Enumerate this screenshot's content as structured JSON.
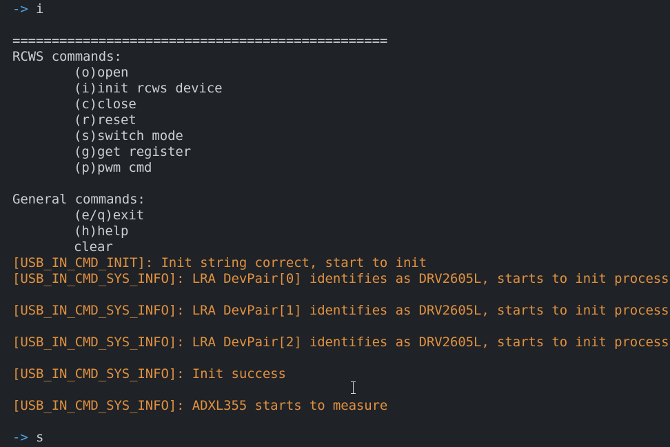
{
  "prompt_symbol": "->",
  "first_command": "i",
  "separator": "================================================",
  "rcws_header": "RCWS commands:",
  "rcws_items": [
    "(o)open",
    "(i)init rcws device",
    "(c)close",
    "(r)reset",
    "(s)switch mode",
    "(g)get register",
    "(p)pwm cmd"
  ],
  "general_header": "General commands:",
  "general_items": [
    "(e/q)exit",
    "(h)help",
    "clear"
  ],
  "log_lines": [
    "[USB_IN_CMD_INIT]: Init string correct, start to init",
    "[USB_IN_CMD_SYS_INFO]: LRA DevPair[0] identifies as DRV2605L, starts to init process",
    "[USB_IN_CMD_SYS_INFO]: LRA DevPair[1] identifies as DRV2605L, starts to init process",
    "[USB_IN_CMD_SYS_INFO]: LRA DevPair[2] identifies as DRV2605L, starts to init process",
    "[USB_IN_CMD_SYS_INFO]: Init success",
    "[USB_IN_CMD_SYS_INFO]: ADXL355 starts to measure"
  ],
  "second_command": "s",
  "colors": {
    "background": "#1f2227",
    "text": "#c9ced6",
    "prompt": "#4fa6e8",
    "log": "#e0913f"
  },
  "mouse_cursor_icon": "i-beam-cursor-icon"
}
